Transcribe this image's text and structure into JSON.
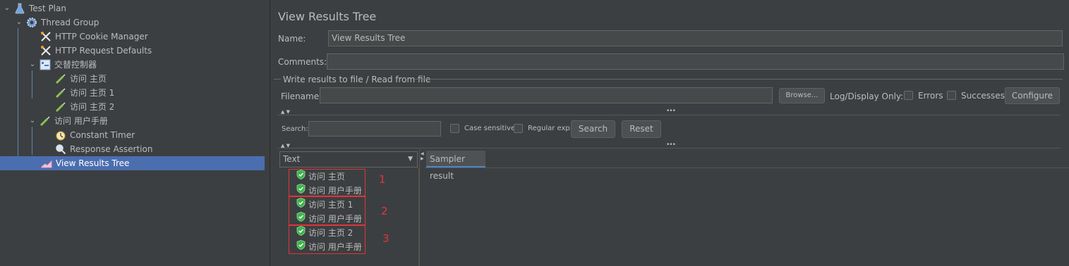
{
  "tree": {
    "items": [
      {
        "label": "Test Plan",
        "icon": "flask-icon",
        "expanded": true
      },
      {
        "label": "Thread Group",
        "icon": "gear-icon",
        "expanded": true
      },
      {
        "label": "HTTP Cookie Manager",
        "icon": "tools-icon"
      },
      {
        "label": "HTTP Request Defaults",
        "icon": "tools-icon"
      },
      {
        "label": "交替控制器",
        "icon": "controller-icon",
        "expanded": true
      },
      {
        "label": "访问 主页",
        "icon": "sampler-icon"
      },
      {
        "label": "访问 主页 1",
        "icon": "sampler-icon"
      },
      {
        "label": "访问 主页 2",
        "icon": "sampler-icon"
      },
      {
        "label": "访问 用户手册",
        "icon": "sampler-icon",
        "expanded": true
      },
      {
        "label": "Constant Timer",
        "icon": "timer-icon"
      },
      {
        "label": "Response Assertion",
        "icon": "magnifier-icon"
      },
      {
        "label": "View Results Tree",
        "icon": "listener-icon",
        "selected": true
      }
    ]
  },
  "panel": {
    "title": "View Results Tree",
    "name_label": "Name:",
    "name_value": "View Results Tree",
    "comments_label": "Comments:",
    "comments_value": "",
    "file_group_label": "Write results to file / Read from file",
    "filename_label": "Filename",
    "filename_value": "",
    "browse_label": "Browse...",
    "log_display_label": "Log/Display Only:",
    "errors_label": "Errors",
    "successes_label": "Successes",
    "configure_label": "Configure",
    "search_label": "Search:",
    "search_value": "",
    "case_sensitive_label": "Case sensitive",
    "regex_label": "Regular exp.",
    "search_button": "Search",
    "reset_button": "Reset",
    "renderer_value": "Text",
    "sampler_tab": "Sampler result"
  },
  "results": {
    "items": [
      "访问 主页",
      "访问 用户手册",
      "访问 主页 1",
      "访问 用户手册",
      "访问 主页 2",
      "访问 用户手册"
    ],
    "annotations": [
      "1",
      "2",
      "3"
    ]
  },
  "colors": {
    "background": "#3c3f41",
    "selection": "#4b6eaf",
    "success": "#3cb44b",
    "annotation": "#e0353a"
  }
}
